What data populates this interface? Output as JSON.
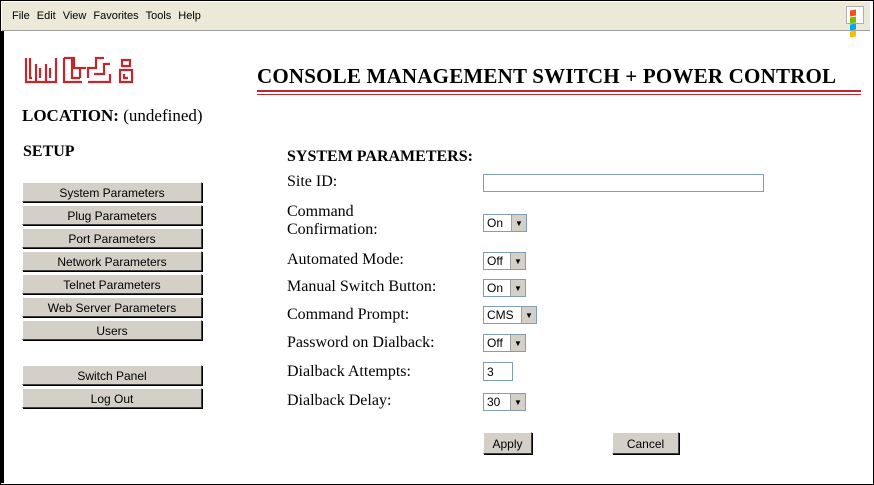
{
  "menu": [
    "File",
    "Edit",
    "View",
    "Favorites",
    "Tools",
    "Help"
  ],
  "logo_text": "wti",
  "brand_color": "#c0282d",
  "page_title": "CONSOLE MANAGEMENT SWITCH + POWER CONTROL",
  "location": {
    "label": "LOCATION:",
    "value": "(undefined)"
  },
  "sidebar": {
    "heading": "SETUP",
    "items": [
      "System Parameters",
      "Plug Parameters",
      "Port Parameters",
      "Network Parameters",
      "Telnet Parameters",
      "Web Server Parameters",
      "Users"
    ],
    "bottom_items": [
      "Switch Panel",
      "Log Out"
    ]
  },
  "form": {
    "heading": "SYSTEM PARAMETERS:",
    "site_id": {
      "label": "Site ID:",
      "value": ""
    },
    "command_confirmation": {
      "label_line1": "Command",
      "label_line2": "Confirmation:",
      "value": "On"
    },
    "automated_mode": {
      "label": "Automated Mode:",
      "value": "Off"
    },
    "manual_switch_button": {
      "label": "Manual Switch Button:",
      "value": "On"
    },
    "command_prompt": {
      "label": "Command Prompt:",
      "value": "CMS"
    },
    "password_on_dialback": {
      "label": "Password on Dialback:",
      "value": "Off"
    },
    "dialback_attempts": {
      "label": "Dialback Attempts:",
      "value": "3"
    },
    "dialback_delay": {
      "label": "Dialback Delay:",
      "value": "30"
    },
    "apply_label": "Apply",
    "cancel_label": "Cancel"
  }
}
